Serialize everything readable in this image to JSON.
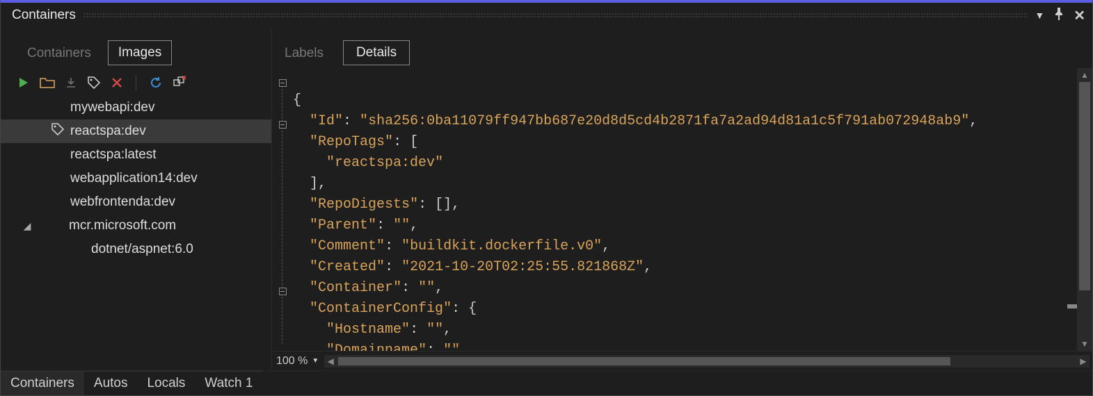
{
  "title": "Containers",
  "titlebar_controls": {
    "menu": "▾",
    "pin": "📌",
    "close": "✕"
  },
  "left": {
    "tabs": [
      "Containers",
      "Images"
    ],
    "active_tab": 1,
    "toolbar": {
      "run": "run-icon",
      "open": "open-folder-icon",
      "pull": "download-icon",
      "tag": "tag-icon",
      "delete": "delete-icon",
      "refresh": "refresh-icon",
      "prune": "prune-icon"
    },
    "tree": [
      {
        "label": "mywebapi:dev",
        "level": 1,
        "selected": false
      },
      {
        "label": "reactspa:dev",
        "level": 1,
        "selected": true,
        "hasTag": true
      },
      {
        "label": "reactspa:latest",
        "level": 1,
        "selected": false
      },
      {
        "label": "webapplication14:dev",
        "level": 1,
        "selected": false
      },
      {
        "label": "webfrontenda:dev",
        "level": 1,
        "selected": false
      },
      {
        "label": "mcr.microsoft.com",
        "level": 0,
        "selected": false,
        "expanded": true
      },
      {
        "label": "dotnet/aspnet:6.0",
        "level": 2,
        "selected": false
      }
    ]
  },
  "right": {
    "tabs": [
      "Labels",
      "Details"
    ],
    "active_tab": 1,
    "zoom": "100 %",
    "json": {
      "Id": "sha256:0ba11079ff947bb687e20d8d5cd4b2871fa7a2ad94d81a1c5f791ab072948ab9",
      "RepoTags_label": "RepoTags",
      "RepoTags_value": "reactspa:dev",
      "RepoDigests_label": "RepoDigests",
      "Parent_label": "Parent",
      "Parent_value": "",
      "Comment_label": "Comment",
      "Comment_value": "buildkit.dockerfile.v0",
      "Created_label": "Created",
      "Created_value": "2021-10-20T02:25:55.821868Z",
      "Container_label": "Container",
      "Container_value": "",
      "ContainerConfig_label": "ContainerConfig",
      "Hostname_label": "Hostname",
      "Hostname_value": "",
      "Domainname_label": "Domainname",
      "Domainname_value": ""
    }
  },
  "bottom_tabs": [
    "Containers",
    "Autos",
    "Locals",
    "Watch 1"
  ],
  "bottom_active": 0
}
